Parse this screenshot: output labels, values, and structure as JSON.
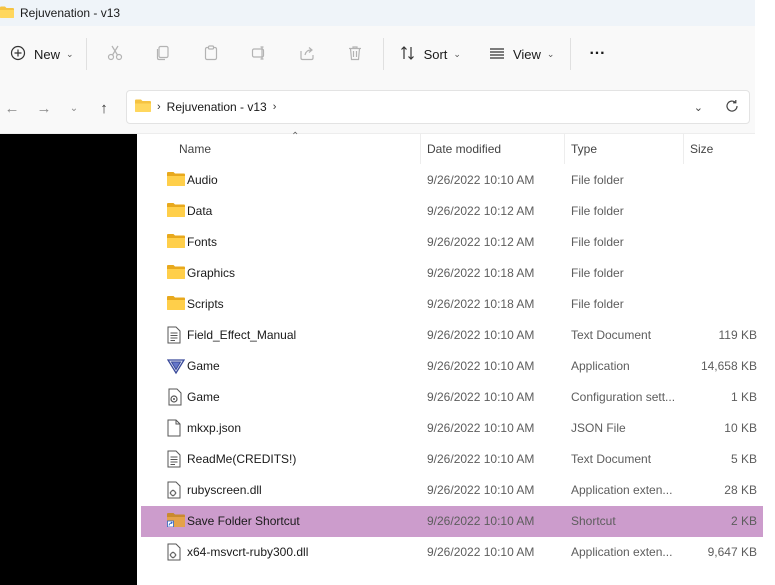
{
  "window": {
    "title": "Rejuvenation - v13"
  },
  "toolbar": {
    "new_label": "New",
    "sort_label": "Sort",
    "view_label": "View",
    "more_label": "···"
  },
  "address": {
    "crumbs": [
      "Rejuvenation - v13"
    ]
  },
  "columns": {
    "name": "Name",
    "date": "Date modified",
    "type": "Type",
    "size": "Size"
  },
  "files": [
    {
      "name": "Audio",
      "date": "9/26/2022 10:10 AM",
      "type": "File folder",
      "size": "",
      "icon": "folder-icon"
    },
    {
      "name": "Data",
      "date": "9/26/2022 10:12 AM",
      "type": "File folder",
      "size": "",
      "icon": "folder-icon"
    },
    {
      "name": "Fonts",
      "date": "9/26/2022 10:12 AM",
      "type": "File folder",
      "size": "",
      "icon": "folder-icon"
    },
    {
      "name": "Graphics",
      "date": "9/26/2022 10:18 AM",
      "type": "File folder",
      "size": "",
      "icon": "folder-icon"
    },
    {
      "name": "Scripts",
      "date": "9/26/2022 10:18 AM",
      "type": "File folder",
      "size": "",
      "icon": "folder-icon"
    },
    {
      "name": "Field_Effect_Manual",
      "date": "9/26/2022 10:10 AM",
      "type": "Text Document",
      "size": "119 KB",
      "icon": "text-document-icon"
    },
    {
      "name": "Game",
      "date": "9/26/2022 10:10 AM",
      "type": "Application",
      "size": "14,658 KB",
      "icon": "application-icon"
    },
    {
      "name": "Game",
      "date": "9/26/2022 10:10 AM",
      "type": "Configuration sett...",
      "size": "1 KB",
      "icon": "config-file-icon"
    },
    {
      "name": "mkxp.json",
      "date": "9/26/2022 10:10 AM",
      "type": "JSON File",
      "size": "10 KB",
      "icon": "blank-file-icon"
    },
    {
      "name": "ReadMe(CREDITS!)",
      "date": "9/26/2022 10:10 AM",
      "type": "Text Document",
      "size": "5 KB",
      "icon": "text-document-icon"
    },
    {
      "name": "rubyscreen.dll",
      "date": "9/26/2022 10:10 AM",
      "type": "Application exten...",
      "size": "28 KB",
      "icon": "dll-file-icon"
    },
    {
      "name": "Save Folder Shortcut",
      "date": "9/26/2022 10:10 AM",
      "type": "Shortcut",
      "size": "2 KB",
      "icon": "folder-shortcut-icon",
      "selected": true
    },
    {
      "name": "x64-msvcrt-ruby300.dll",
      "date": "9/26/2022 10:10 AM",
      "type": "Application exten...",
      "size": "9,647 KB",
      "icon": "dll-file-icon"
    }
  ],
  "colors": {
    "folder": "#f5c342",
    "selected_row": "#cc9ccc",
    "accent": "#0067c0"
  }
}
